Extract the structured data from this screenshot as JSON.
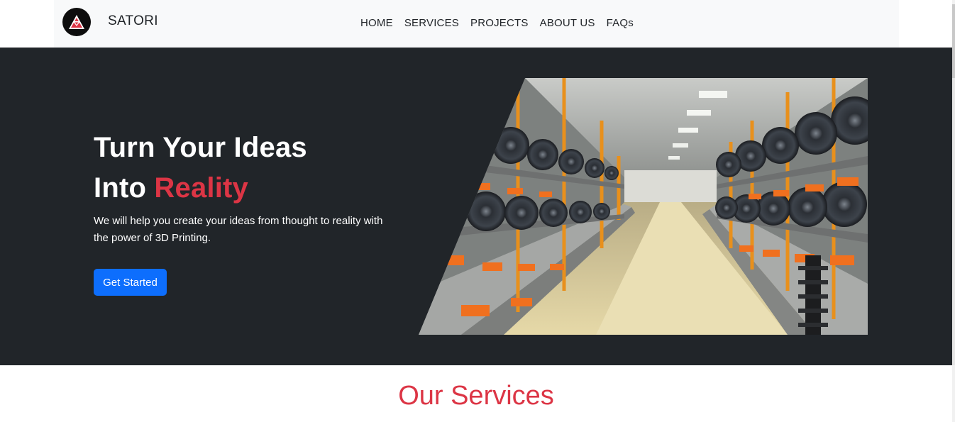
{
  "navbar": {
    "brand": "SATORI",
    "logo_icon": "satori-triangle-logo-icon",
    "links": [
      "HOME",
      "SERVICES",
      "PROJECTS",
      "ABOUT US",
      "FAQs"
    ]
  },
  "hero": {
    "title_line1": "Turn Your Ideas",
    "title_line2_prefix": "Into ",
    "title_line2_accent": "Reality",
    "description": "We will help you create your ideas from thought to reality with the power of 3D Printing.",
    "cta_label": "Get Started",
    "image_subject": "3d-printer-farm-image"
  },
  "services": {
    "title": "Our Services"
  },
  "colors": {
    "accent_red": "#dc3545",
    "primary_blue": "#0d6efd",
    "hero_bg": "#212529",
    "navbar_bg": "#f8f9fa"
  }
}
